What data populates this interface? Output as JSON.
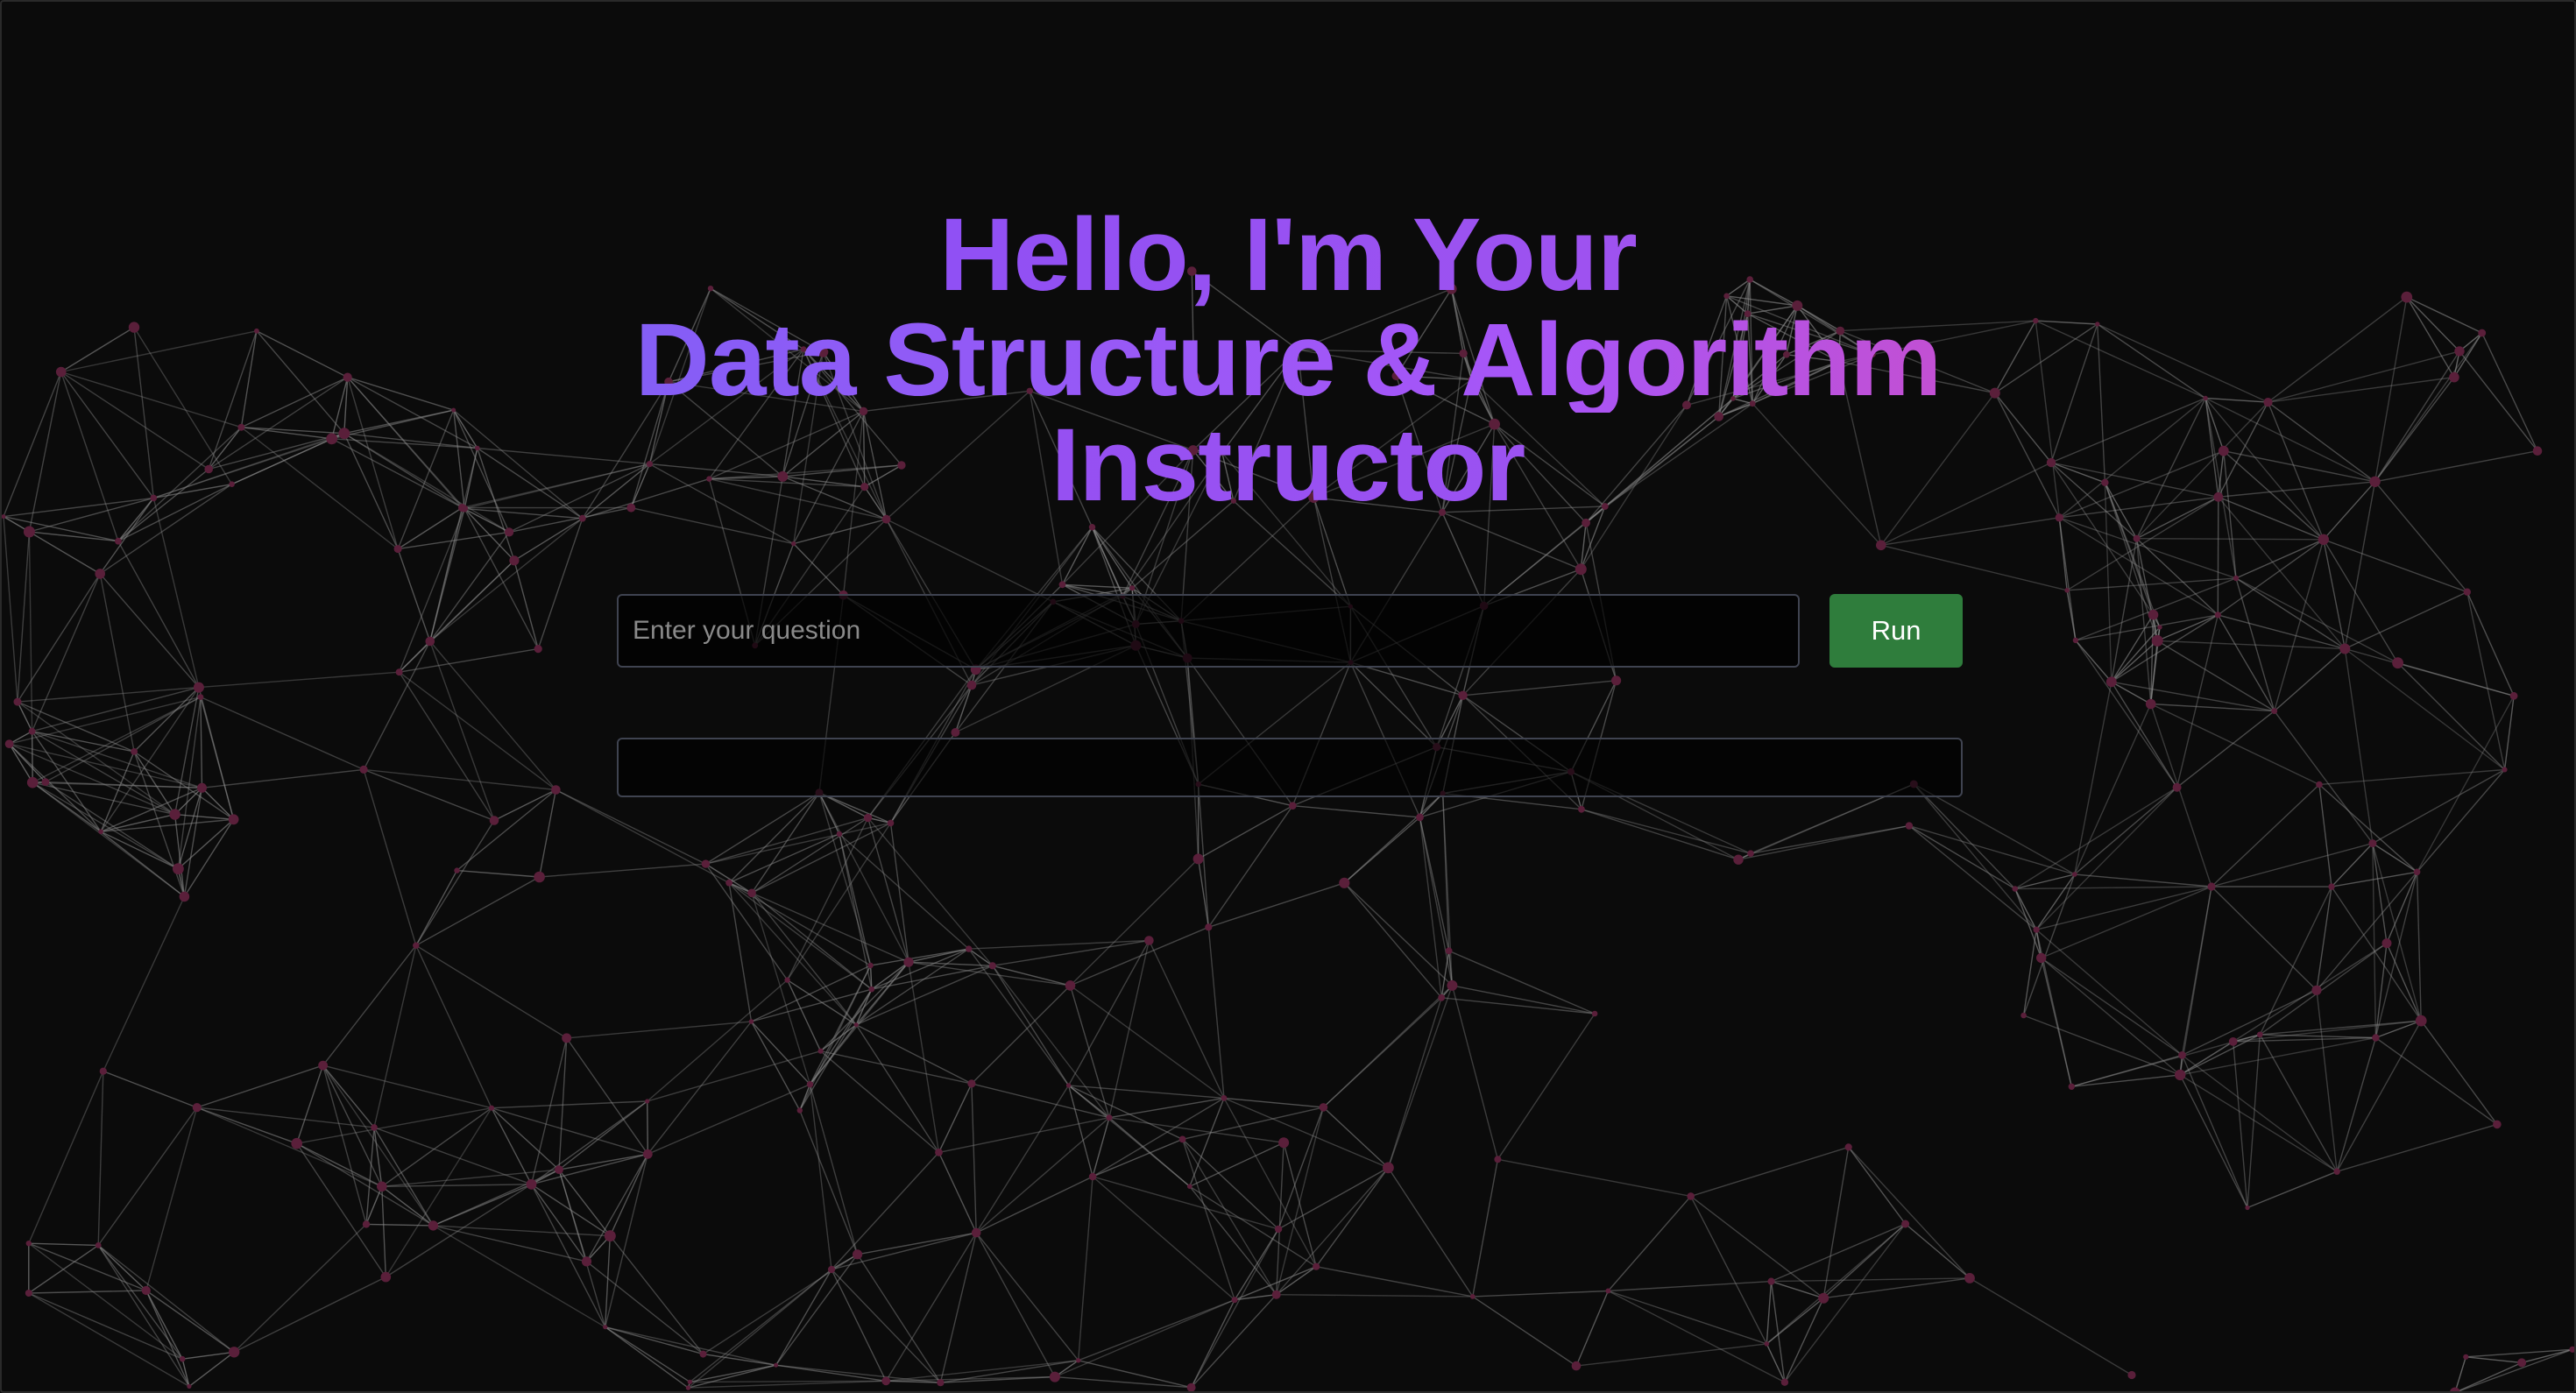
{
  "header": {
    "title_line1": "Hello, I'm Your",
    "title_line2": "Data Structure & Algorithm",
    "title_line3": "Instructor"
  },
  "query": {
    "placeholder": "Enter your question",
    "value": "",
    "run_label": "Run"
  },
  "output": {
    "text": ""
  },
  "background": {
    "type": "particle-network",
    "node_color": "#5a1f3a",
    "line_color": "#8a8a8a",
    "base_color": "#0b0b0b"
  },
  "colors": {
    "gradient_start": "#6366f1",
    "gradient_mid": "#a855f7",
    "gradient_end": "#ec4899",
    "run_button": "#2f7d3c"
  }
}
